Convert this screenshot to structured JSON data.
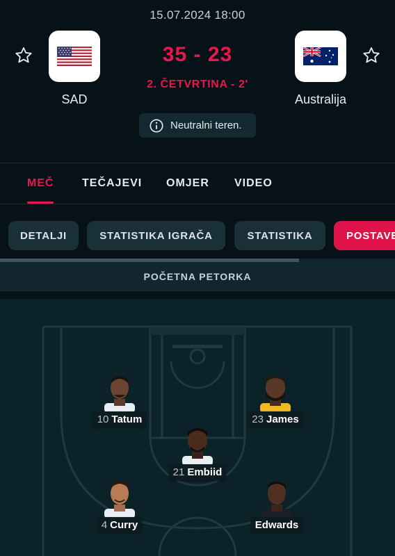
{
  "match": {
    "datetime": "15.07.2024 18:00",
    "score": "35 - 23",
    "period": "2. ČETVRTINA - 2'",
    "venue": "Neutralni teren."
  },
  "home": {
    "name": "SAD",
    "flag": "usa-flag-icon"
  },
  "away": {
    "name": "Australija",
    "flag": "australia-flag-icon"
  },
  "tabs": [
    {
      "label": "MEČ",
      "active": true
    },
    {
      "label": "TEČAJEVI",
      "active": false
    },
    {
      "label": "OMJER",
      "active": false
    },
    {
      "label": "VIDEO",
      "active": false
    }
  ],
  "subtabs": [
    {
      "label": "DETALJI",
      "active": false
    },
    {
      "label": "STATISTIKA IGRAČA",
      "active": false
    },
    {
      "label": "STATISTIKA",
      "active": false
    },
    {
      "label": "POSTAVE",
      "active": true
    }
  ],
  "lineup": {
    "title": "POČETNA PETORKA",
    "players": [
      {
        "number": "10",
        "name": "Tatum"
      },
      {
        "number": "23",
        "name": "James"
      },
      {
        "number": "21",
        "name": "Embiid"
      },
      {
        "number": "4",
        "name": "Curry"
      },
      {
        "number": "",
        "name": "Edwards"
      }
    ]
  },
  "colors": {
    "accent": "#e8194a",
    "background": "#061218",
    "court": "#0b2228"
  }
}
